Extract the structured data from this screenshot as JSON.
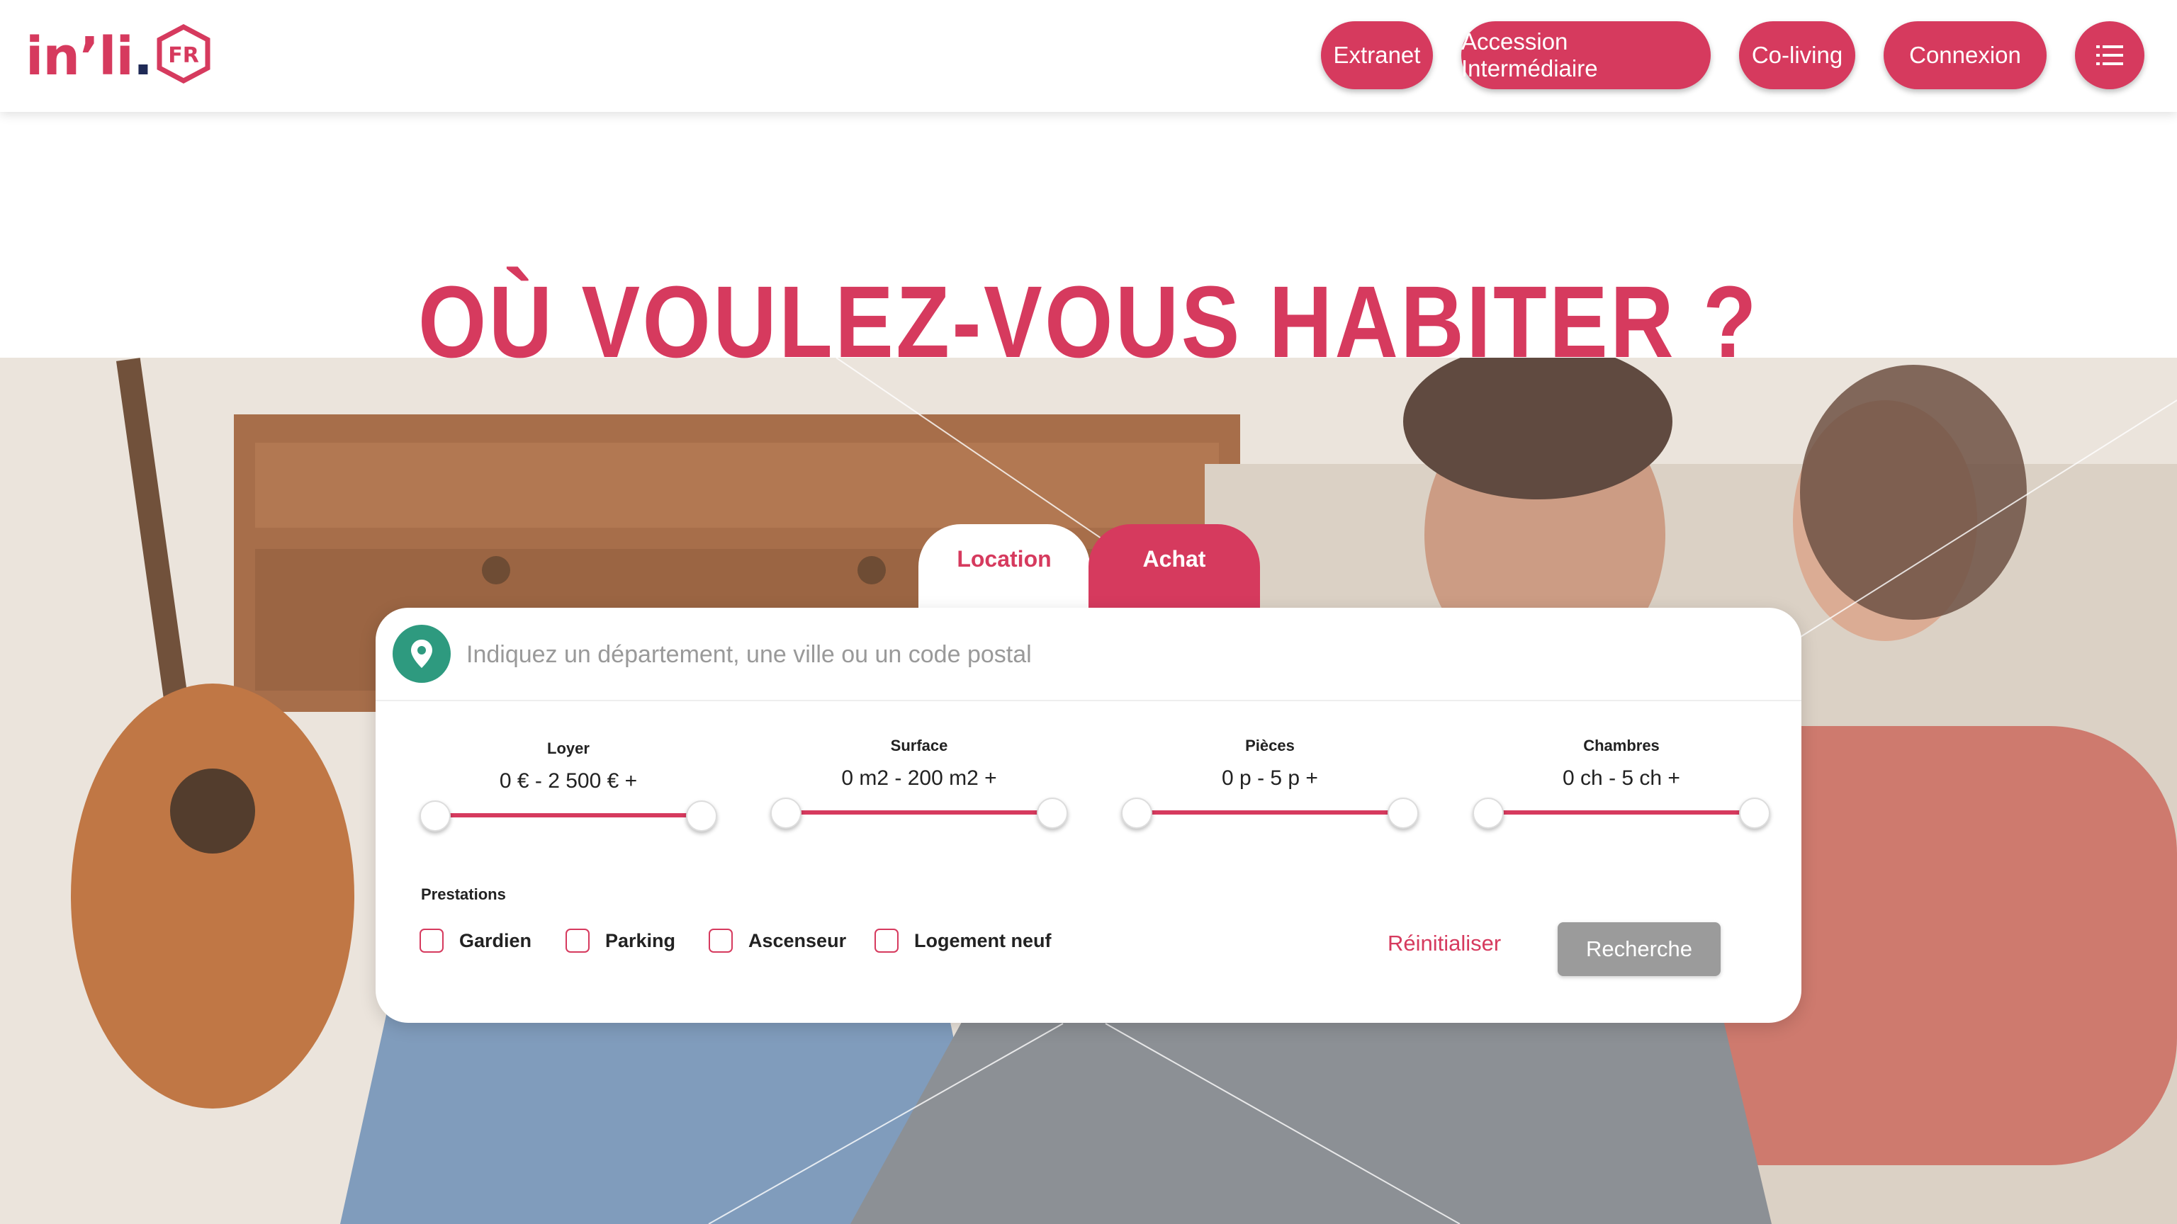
{
  "brand": {
    "logo_text": "in’li",
    "logo_dot": ".",
    "logo_badge": "FR",
    "accent": "#d63a5e",
    "navy": "#1f2a56",
    "green": "#2e9a7f"
  },
  "nav": {
    "extranet": "Extranet",
    "accession": "Accession Intermédiaire",
    "coliving": "Co-living",
    "connexion": "Connexion",
    "menu_icon": "menu-icon"
  },
  "hero": {
    "title": "OÙ VOULEZ-VOUS HABITER ?"
  },
  "tabs": {
    "location": "Location",
    "achat": "Achat",
    "active": "Location"
  },
  "search": {
    "placeholder": "Indiquez un département, une ville ou un code postal",
    "filters": [
      {
        "label": "Loyer",
        "value": "0 € - 2 500 € +"
      },
      {
        "label": "Surface",
        "value": "0 m2 - 200 m2 +"
      },
      {
        "label": "Pièces",
        "value": "0 p - 5 p +"
      },
      {
        "label": "Chambres",
        "value": "0 ch - 5 ch +"
      }
    ],
    "prestations_label": "Prestations",
    "prestations": [
      "Gardien",
      "Parking",
      "Ascenseur",
      "Logement neuf"
    ],
    "reset_label": "Réinitialiser",
    "submit_label": "Recherche"
  }
}
